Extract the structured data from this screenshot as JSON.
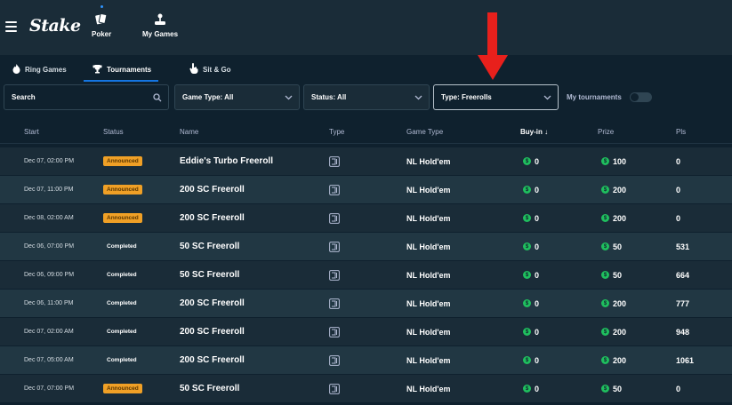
{
  "header": {
    "logo": "Stake",
    "nav": [
      {
        "label": "Poker",
        "icon": "poker-cards-icon"
      },
      {
        "label": "My Games",
        "icon": "joystick-icon"
      }
    ]
  },
  "subtabs": [
    {
      "label": "Ring Games",
      "icon": "fire-icon"
    },
    {
      "label": "Tournaments",
      "icon": "trophy-icon",
      "active": true
    },
    {
      "label": "Sit & Go",
      "icon": "hand-pointer-icon"
    }
  ],
  "filters": {
    "search_placeholder": "Search",
    "game_type": "Game Type: All",
    "status": "Status: All",
    "type": "Type: Freerolls",
    "my_tournaments_label": "My tournaments",
    "my_tournaments_on": false
  },
  "table": {
    "columns": {
      "start": "Start",
      "status": "Status",
      "name": "Name",
      "type": "Type",
      "game_type": "Game Type",
      "buyin": "Buy-in ↓",
      "prize": "Prize",
      "pls": "Pls"
    },
    "rows": [
      {
        "start": "Dec 07, 02:00 PM",
        "status": "Announced",
        "name": "Eddie's Turbo Freeroll",
        "game_type": "NL Hold'em",
        "buyin": "0",
        "prize": "100",
        "pls": "0"
      },
      {
        "start": "Dec 07, 11:00 PM",
        "status": "Announced",
        "name": "200 SC Freeroll",
        "game_type": "NL Hold'em",
        "buyin": "0",
        "prize": "200",
        "pls": "0"
      },
      {
        "start": "Dec 08, 02:00 AM",
        "status": "Announced",
        "name": "200 SC Freeroll",
        "game_type": "NL Hold'em",
        "buyin": "0",
        "prize": "200",
        "pls": "0"
      },
      {
        "start": "Dec 06, 07:00 PM",
        "status": "Completed",
        "name": "50 SC Freeroll",
        "game_type": "NL Hold'em",
        "buyin": "0",
        "prize": "50",
        "pls": "531"
      },
      {
        "start": "Dec 06, 09:00 PM",
        "status": "Completed",
        "name": "50 SC Freeroll",
        "game_type": "NL Hold'em",
        "buyin": "0",
        "prize": "50",
        "pls": "664"
      },
      {
        "start": "Dec 06, 11:00 PM",
        "status": "Completed",
        "name": "200 SC Freeroll",
        "game_type": "NL Hold'em",
        "buyin": "0",
        "prize": "200",
        "pls": "777"
      },
      {
        "start": "Dec 07, 02:00 AM",
        "status": "Completed",
        "name": "200 SC Freeroll",
        "game_type": "NL Hold'em",
        "buyin": "0",
        "prize": "200",
        "pls": "948"
      },
      {
        "start": "Dec 07, 05:00 AM",
        "status": "Completed",
        "name": "200 SC Freeroll",
        "game_type": "NL Hold'em",
        "buyin": "0",
        "prize": "200",
        "pls": "1061"
      },
      {
        "start": "Dec 07, 07:00 PM",
        "status": "Announced",
        "name": "50 SC Freeroll",
        "game_type": "NL Hold'em",
        "buyin": "0",
        "prize": "50",
        "pls": "0"
      }
    ]
  },
  "colors": {
    "background": "#0f212e",
    "panel": "#1a2c38",
    "row_alt": "#213743",
    "announced": "#f0a026",
    "coin": "#1fbf5e",
    "accent": "#1475e1",
    "annotation_arrow": "#e8201c"
  }
}
